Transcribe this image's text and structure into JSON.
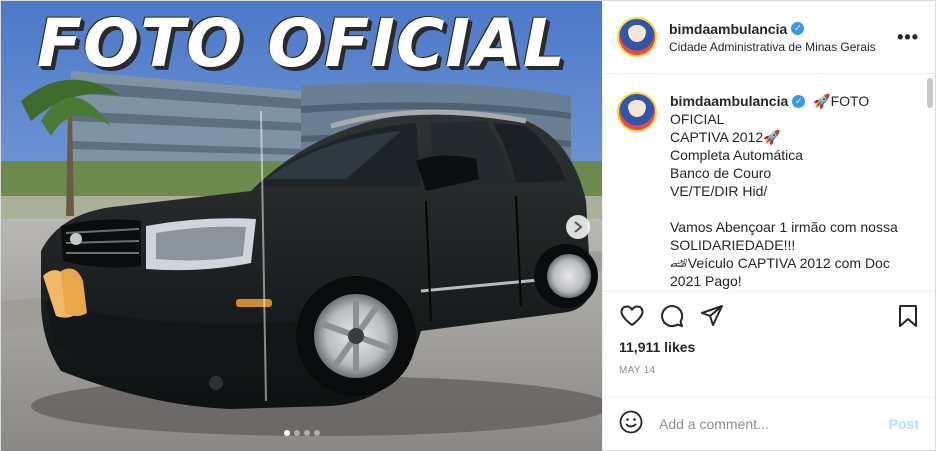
{
  "media": {
    "overlay_title": "FOTO OFICIAL",
    "carousel_dots": 4,
    "active_dot": 0,
    "next_icon": "chevron-right-icon"
  },
  "header": {
    "username": "bimdaambulancia",
    "verified": true,
    "location": "Cidade Administrativa de Minas Gerais",
    "more_icon": "more-horizontal-icon"
  },
  "caption": {
    "username": "bimdaambulancia",
    "lines": [
      "🚀FOTO OFICIAL",
      "CAPTIVA 2012🚀",
      "Completa Automática",
      "Banco de Couro",
      "VE/TE/DIR Hid/",
      "",
      "Vamos Abençoar 1 irmão com nossa",
      "SOLIDARIEDADE!!!",
      "🏎Veículo CAPTIVA 2012 com Doc",
      "2021 Pago!"
    ]
  },
  "actions": {
    "like_icon": "heart-icon",
    "comment_icon": "comment-icon",
    "share_icon": "paper-plane-icon",
    "save_icon": "bookmark-icon"
  },
  "likes": "11,911 likes",
  "date": "MAY 14",
  "comment_box": {
    "emoji_icon": "smiley-icon",
    "placeholder": "Add a comment...",
    "post_label": "Post"
  },
  "colors": {
    "verified": "#3897f0",
    "post_button": "#b2dffc",
    "muted": "#8e8e8e"
  }
}
